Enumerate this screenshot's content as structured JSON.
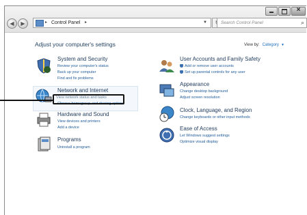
{
  "window": {
    "address": {
      "crumbs": [
        "Control Panel"
      ]
    },
    "search": {
      "placeholder": "Search Control Panel"
    }
  },
  "page": {
    "heading": "Adjust your computer's settings",
    "view_by": {
      "label": "View by:",
      "value": "Category"
    }
  },
  "categories": [
    {
      "title": "System and Security",
      "icon": "shield-icon",
      "links": [
        "Review your computer's status",
        "Back up your computer",
        "Find and fix problems"
      ]
    },
    {
      "title": "Network and Internet",
      "icon": "network-icon",
      "links": [
        "View network status and tasks",
        "Choose homegroup and sharing options"
      ]
    },
    {
      "title": "Hardware and Sound",
      "icon": "printer-icon",
      "links": [
        "View devices and printers",
        "Add a device"
      ]
    },
    {
      "title": "Programs",
      "icon": "programs-icon",
      "links": [
        "Uninstall a program"
      ]
    },
    {
      "title": "User Accounts and Family Safety",
      "icon": "users-icon",
      "links": [
        "Add or remove user accounts",
        "Set up parental controls for any user"
      ]
    },
    {
      "title": "Appearance",
      "icon": "appearance-icon",
      "links": [
        "Change desktop background",
        "Adjust screen resolution"
      ]
    },
    {
      "title": "Clock, Language, and Region",
      "icon": "clock-globe-icon",
      "links": [
        "Change keyboards or other input methods"
      ]
    },
    {
      "title": "Ease of Access",
      "icon": "ease-of-access-icon",
      "links": [
        "Let Windows suggest settings",
        "Optimize visual display"
      ]
    }
  ],
  "colors": {
    "link": "#1e5a9a",
    "title": "#1e395b",
    "accent": "#3a6fb2"
  }
}
